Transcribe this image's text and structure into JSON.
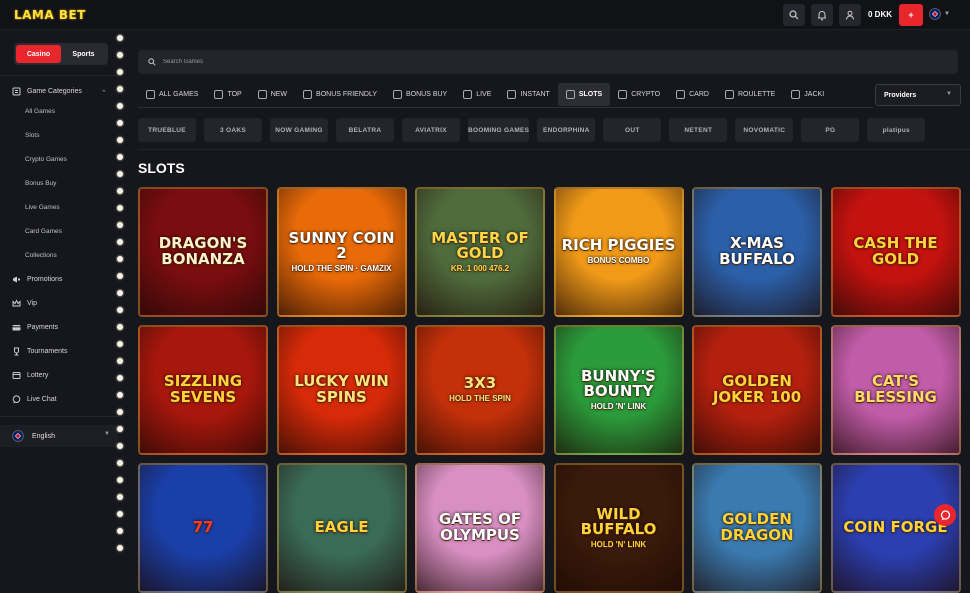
{
  "brand": {
    "logo": "LAMA BET"
  },
  "topbar": {
    "balance": "0 DKK",
    "deposit_label": "+"
  },
  "sidebar": {
    "toggle": {
      "casino": "Casino",
      "sports": "Sports"
    },
    "categories_label": "Game Categories",
    "sub_items": [
      "All Games",
      "Slots",
      "Crypto Games",
      "Bonus Buy",
      "Live Games",
      "Card Games",
      "Collections"
    ],
    "items": [
      "Promotions",
      "Vip",
      "Payments",
      "Tournaments",
      "Lottery",
      "Live Chat"
    ],
    "language": "English"
  },
  "search": {
    "placeholder": "Search Games"
  },
  "tabs": [
    "ALL GAMES",
    "TOP",
    "NEW",
    "BONUS FRIENDLY",
    "BONUS BUY",
    "LIVE",
    "INSTANT",
    "SLOTS",
    "CRYPTO",
    "CARD",
    "ROULETTE",
    "JACKI"
  ],
  "active_tab": "SLOTS",
  "providers_label": "Providers",
  "provider_logos": [
    "TRUEBLUE",
    "3 OAKS",
    "NOW GAMING",
    "BELATRA",
    "AVIATRIX",
    "BOOMING GAMES",
    "ENDORPHINA",
    "OUT",
    "NETENT",
    "NOVOMATIC",
    "PG",
    "platipus"
  ],
  "section_title": "SLOTS",
  "games": [
    {
      "title": "Dragon's Bonanza",
      "sub": "",
      "bg": "#7a0d10",
      "fg": "#fff1c8"
    },
    {
      "title": "Sunny Coin 2",
      "sub": "HOLD THE SPIN · GAMZIX",
      "bg": "#e86a08",
      "fg": "#ffffff"
    },
    {
      "title": "Master of Gold",
      "sub": "kr. 1 000 476.2",
      "bg": "#4f6b3c",
      "fg": "#ffd54a"
    },
    {
      "title": "Rich Piggies",
      "sub": "BONUS COMBO",
      "bg": "#f09a18",
      "fg": "#ffffff"
    },
    {
      "title": "X-Mas Buffalo",
      "sub": "",
      "bg": "#2b5fa8",
      "fg": "#ffffff"
    },
    {
      "title": "Cash the Gold",
      "sub": "",
      "bg": "#c4120f",
      "fg": "#ffd23a"
    },
    {
      "title": "Sizzling Sevens",
      "sub": "",
      "bg": "#a8170c",
      "fg": "#ffd23a"
    },
    {
      "title": "Lucky Win Spins",
      "sub": "",
      "bg": "#d62a08",
      "fg": "#ffe27a"
    },
    {
      "title": "3x3",
      "sub": "HOLD THE SPIN",
      "bg": "#c4300a",
      "fg": "#ffe27a"
    },
    {
      "title": "Bunny's Bounty",
      "sub": "HOLD 'N' LINK",
      "bg": "#2b9a3a",
      "fg": "#ffffff"
    },
    {
      "title": "Golden Joker 100",
      "sub": "",
      "bg": "#b5200e",
      "fg": "#ffd23a"
    },
    {
      "title": "Cat's Blessing",
      "sub": "",
      "bg": "#c15ca8",
      "fg": "#ffd86a"
    },
    {
      "title": "77",
      "sub": "",
      "bg": "#1a3fa8",
      "fg": "#ff3a2a"
    },
    {
      "title": "Eagle",
      "sub": "",
      "bg": "#3a6a58",
      "fg": "#ffd23a"
    },
    {
      "title": "Gates of Olympus",
      "sub": "",
      "bg": "#d88fc2",
      "fg": "#ffffff"
    },
    {
      "title": "Wild Buffalo",
      "sub": "HOLD 'N' LINK",
      "bg": "#3a1a0a",
      "fg": "#ffd23a"
    },
    {
      "title": "Golden Dragon",
      "sub": "",
      "bg": "#3a7ab0",
      "fg": "#ffd23a"
    },
    {
      "title": "Coin Forge",
      "sub": "",
      "bg": "#2b3fb0",
      "fg": "#ffd23a"
    }
  ]
}
